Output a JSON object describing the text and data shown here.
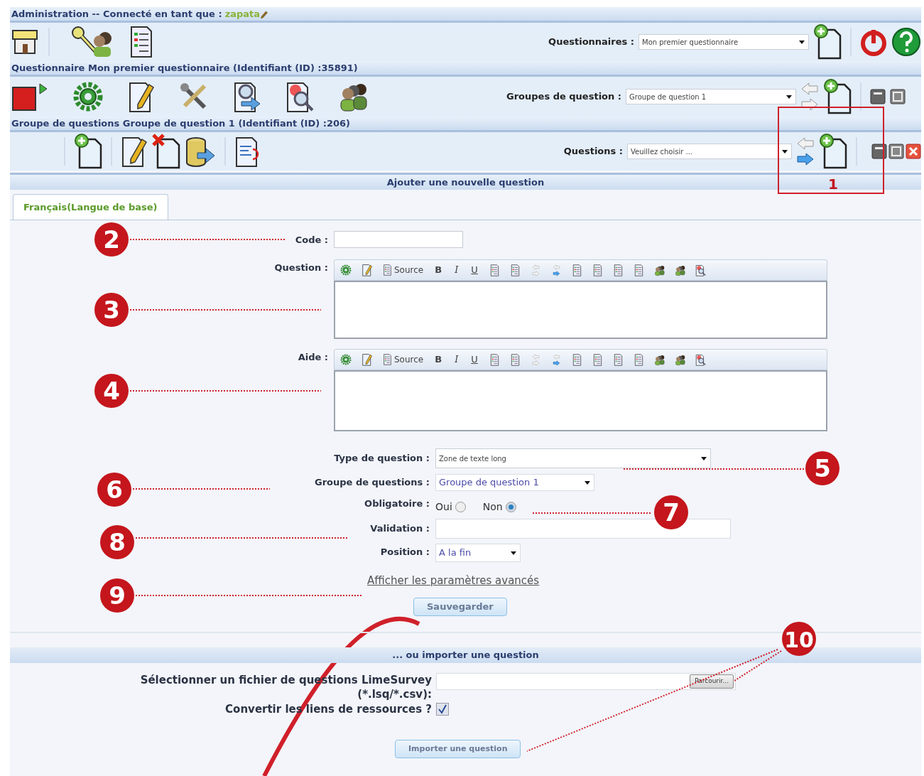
{
  "admin_bar": {
    "text": "Administration -- Connecté en tant que :",
    "user": "zapata"
  },
  "survey_select": {
    "label": "Questionnaires :",
    "value": "Mon premier questionnaire"
  },
  "survey_bar": "Questionnaire Mon premier questionnaire (Identifiant (ID) :35891)",
  "group_select": {
    "label": "Groupes de question :",
    "value": "Groupe de question 1"
  },
  "group_bar": "Groupe de questions Groupe de question 1 (Identifiant (ID) :206)",
  "question_select": {
    "label": "Questions :",
    "value": "Veuillez choisir ..."
  },
  "section_title": "Ajouter une nouvelle question",
  "tabs": [
    {
      "label": "Français(Langue de base)",
      "selected": true
    }
  ],
  "code": {
    "label": "Code :"
  },
  "editors": [
    {
      "label": "Question :",
      "buttons": [
        "Source",
        "B",
        "I",
        "U"
      ]
    },
    {
      "label": "Aide :",
      "buttons": [
        "Source",
        "B",
        "I",
        "U"
      ]
    }
  ],
  "question_type": {
    "label": "Type de question :",
    "value": "Zone de texte long"
  },
  "question_group": {
    "label": "Groupe de questions :",
    "value": "Groupe de question 1"
  },
  "mandatory": {
    "label": "Obligatoire :",
    "options": [
      {
        "label": "Oui",
        "selected": false
      },
      {
        "label": "Non",
        "selected": true
      }
    ]
  },
  "validation": {
    "label": "Validation :"
  },
  "position": {
    "label": "Position :",
    "value": "A la fin"
  },
  "advanced_link": "Afficher les paramètres avancés",
  "save_button": "Sauvegarder",
  "import_title": "... ou importer une question",
  "import_file": {
    "label": "Sélectionner un fichier de questions LimeSurvey (*.lsq/*.csv):",
    "browse": "Parcourir..."
  },
  "convert_links": {
    "label": "Convertir les liens de ressources ?",
    "checked": true
  },
  "import_button": "Importer une question",
  "callouts": [
    "1",
    "2",
    "3",
    "4",
    "5",
    "6",
    "7",
    "8",
    "9",
    "10"
  ]
}
